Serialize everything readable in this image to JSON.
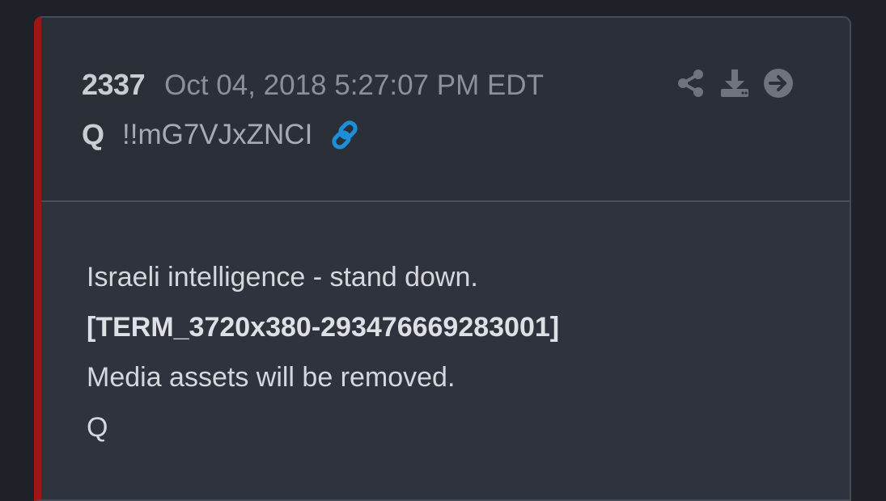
{
  "post": {
    "number": "2337",
    "timestamp": "Oct 04, 2018 5:27:07 PM EDT",
    "author": "Q",
    "tripcode": "!!mG7VJxZNCI",
    "lines": [
      "Israeli intelligence - stand down.",
      "[TERM_3720x380-293476669283001]",
      "Media assets will be removed.",
      "Q"
    ]
  },
  "icons": {
    "link": "link-icon",
    "share": "share-icon",
    "download": "download-icon",
    "next": "arrow-right-circle-icon"
  },
  "colors": {
    "accent_border": "#a31515",
    "link_blue": "#1d8fd8",
    "icon_gray": "#6e737c"
  }
}
